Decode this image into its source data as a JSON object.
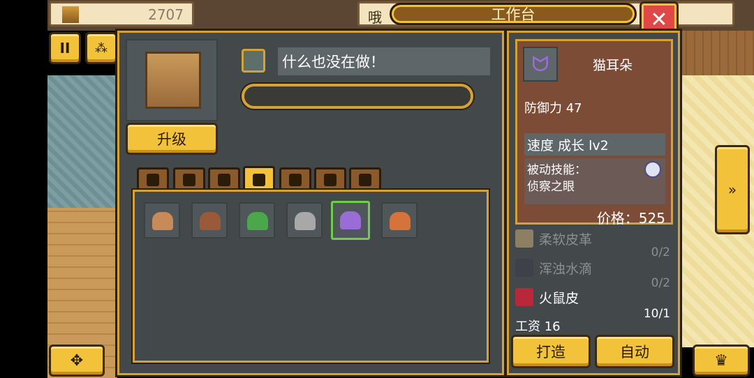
{
  "top_bar": {
    "gold_value": "2707",
    "greeting_fragment": "哦",
    "window_title": "工作台"
  },
  "workstation": {
    "status_text": "什么也没在做！",
    "upgrade_label": "升级",
    "progress": 0
  },
  "tabs": [
    {
      "name": "tab-material",
      "active": false
    },
    {
      "name": "tab-weapon",
      "active": false
    },
    {
      "name": "tab-staff",
      "active": false
    },
    {
      "name": "tab-helmet",
      "active": true
    },
    {
      "name": "tab-armor",
      "active": false
    },
    {
      "name": "tab-ring",
      "active": false
    },
    {
      "name": "tab-tool",
      "active": false
    }
  ],
  "items": [
    {
      "name": "straw-hat-icon",
      "selected": false
    },
    {
      "name": "leather-hood-icon",
      "selected": false
    },
    {
      "name": "green-cap-icon",
      "selected": false
    },
    {
      "name": "feather-hat-icon",
      "selected": false
    },
    {
      "name": "cat-ears-icon",
      "selected": true
    },
    {
      "name": "bronze-helmet-icon",
      "selected": false
    }
  ],
  "detail": {
    "item_name": "猫耳朵",
    "defense_label": "防御力 47",
    "growth_label": "速度 成长 lv2",
    "passive_label": "被动技能：",
    "passive_name": "侦察之眼",
    "price_label": "价格：525"
  },
  "materials": [
    {
      "label": "柔软皮革",
      "count": "0/2",
      "available": false,
      "icon": "soft-leather-icon"
    },
    {
      "label": "浑浊水滴",
      "count": "0/2",
      "available": false,
      "icon": "water-drop-icon"
    },
    {
      "label": "火鼠皮",
      "count": "10/1",
      "available": true,
      "icon": "fire-rat-skin-icon"
    }
  ],
  "wage_label": "工资 16",
  "actions": {
    "craft_label": "打造",
    "auto_label": "自动"
  },
  "colors": {
    "gold": "#f2c23a",
    "panel": "#43484b",
    "detail_bg": "#7c4c36",
    "border": "#d6a233",
    "close_red": "#e04848"
  }
}
